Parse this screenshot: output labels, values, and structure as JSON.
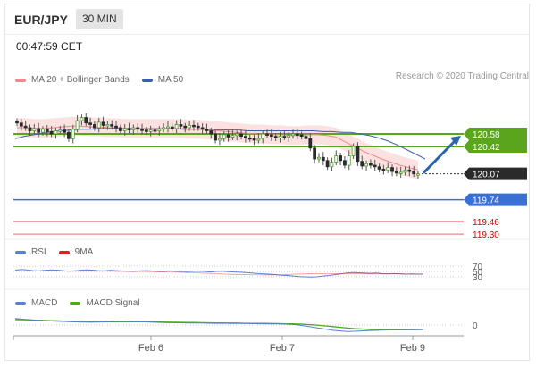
{
  "header": {
    "symbol": "EUR/JPY",
    "timeframe": "30 MIN",
    "time": "00:47:59 CET"
  },
  "credit": "Research © 2020 Trading Central",
  "colors": {
    "bull": "#4a9a2a",
    "green_line": "#5aa51c",
    "blue_line": "#3a6fd8",
    "red_line": "#e56b6b",
    "ma20": "#f08a8a",
    "ma50": "#3d5fa8",
    "band": "#fbd7d7",
    "arrow": "#2a66a8",
    "rsi": "#5b7fd4",
    "rsi9": "#e02020",
    "macd": "#5b7fd4",
    "signal": "#4caa18"
  },
  "legend": {
    "ma20": "MA 20 + Bollinger Bands",
    "ma50": "MA 50",
    "rsi": "RSI",
    "rsi9": "9MA",
    "macd": "MACD",
    "macd_signal": "MACD Signal"
  },
  "chart_data": [
    {
      "type": "line",
      "title": "",
      "y_range": [
        119.2,
        120.9
      ],
      "x_ticks": [
        "Feb 6",
        "Feb 7",
        "Feb 9"
      ],
      "candles_close": [
        120.72,
        120.68,
        120.66,
        120.62,
        120.65,
        120.6,
        120.64,
        120.61,
        120.58,
        120.62,
        120.63,
        120.6,
        120.52,
        120.64,
        120.75,
        120.79,
        120.72,
        120.7,
        120.66,
        120.73,
        120.69,
        120.7,
        120.68,
        120.66,
        120.62,
        120.65,
        120.63,
        120.66,
        120.64,
        120.63,
        120.61,
        120.63,
        120.62,
        120.64,
        120.66,
        120.67,
        120.65,
        120.7,
        120.68,
        120.66,
        120.69,
        120.68,
        120.66,
        120.64,
        120.62,
        120.58,
        120.5,
        120.52,
        120.57,
        120.54,
        120.56,
        120.58,
        120.55,
        120.53,
        120.52,
        120.5,
        120.52,
        120.58,
        120.57,
        120.55,
        120.53,
        120.55,
        120.54,
        120.56,
        120.58,
        120.57,
        120.55,
        120.52,
        120.4,
        120.26,
        120.28,
        120.24,
        120.16,
        120.22,
        120.3,
        120.24,
        120.18,
        120.3,
        120.42,
        120.23,
        120.17,
        120.2,
        120.18,
        120.16,
        120.13,
        120.12,
        120.15,
        120.1,
        120.08,
        120.09,
        120.12,
        120.1,
        120.07,
        120.07
      ],
      "ma50": [
        120.52,
        120.55,
        120.57,
        120.59,
        120.61,
        120.62,
        120.63,
        120.64,
        120.64,
        120.65,
        120.65,
        120.65,
        120.65,
        120.65,
        120.65,
        120.65,
        120.65,
        120.65,
        120.64,
        120.64,
        120.64,
        120.63,
        120.63,
        120.63,
        120.63,
        120.62,
        120.62,
        120.62,
        120.62,
        120.62,
        120.62,
        120.62,
        120.62,
        120.61,
        120.61,
        120.6,
        120.6,
        120.58,
        120.56,
        120.53,
        120.49,
        120.44,
        120.38,
        120.32,
        120.26
      ],
      "ma20": [
        120.66,
        120.66,
        120.65,
        120.65,
        120.66,
        120.67,
        120.68,
        120.68,
        120.67,
        120.67,
        120.66,
        120.66,
        120.65,
        120.65,
        120.65,
        120.65,
        120.65,
        120.65,
        120.65,
        120.64,
        120.64,
        120.63,
        120.62,
        120.61,
        120.6,
        120.59,
        120.58,
        120.58,
        120.57,
        120.57,
        120.56,
        120.56,
        120.57,
        120.57,
        120.56,
        120.54,
        120.48,
        120.42,
        120.36,
        120.31,
        120.26,
        120.22,
        120.18,
        120.15,
        120.12
      ],
      "levels": [
        {
          "label": "120.58",
          "value": 120.58,
          "color": "green"
        },
        {
          "label": "120.42",
          "value": 120.42,
          "color": "green"
        },
        {
          "label": "120.07",
          "value": 120.07,
          "color": "current"
        },
        {
          "label": "119.74",
          "value": 119.74,
          "color": "blue"
        },
        {
          "label": "119.46",
          "value": 119.46,
          "color": "red"
        },
        {
          "label": "119.30",
          "value": 119.3,
          "color": "red"
        }
      ],
      "forecast_arrow": {
        "from": 120.07,
        "to": 120.58
      }
    },
    {
      "type": "line",
      "title": "RSI",
      "y_range": [
        20,
        80
      ],
      "y_ticks": [
        "70",
        "50",
        "30"
      ],
      "rsi": [
        55,
        57,
        56,
        53,
        52,
        54,
        56,
        55,
        53,
        51,
        52,
        54,
        56,
        55,
        53,
        52,
        54,
        53,
        52,
        51,
        50,
        52,
        53,
        52,
        51,
        50,
        52,
        51,
        50,
        49,
        50,
        51,
        50,
        48,
        50,
        51,
        49,
        48,
        47,
        46,
        44,
        42,
        41,
        40,
        38,
        36,
        35,
        33,
        31,
        30,
        29,
        30,
        33,
        35,
        38,
        41,
        44,
        46,
        45,
        44,
        43,
        44,
        42,
        41,
        42,
        41,
        40,
        41,
        40,
        40
      ],
      "ma9": [
        52,
        52,
        52,
        52,
        52,
        51,
        51,
        51,
        51,
        50,
        50,
        50,
        49,
        48,
        47,
        45,
        44,
        42,
        40,
        39,
        38,
        37,
        37,
        38,
        40,
        41,
        42,
        42,
        42,
        42,
        41,
        41,
        41,
        41,
        40,
        40
      ]
    },
    {
      "type": "line",
      "title": "MACD",
      "y_range": [
        -0.15,
        0.15
      ],
      "y_ticks": [
        "0"
      ],
      "macd": [
        0.06,
        0.055,
        0.05,
        0.045,
        0.04,
        0.038,
        0.035,
        0.033,
        0.03,
        0.028,
        0.027,
        0.026,
        0.028,
        0.03,
        0.033,
        0.035,
        0.034,
        0.032,
        0.03,
        0.028,
        0.026,
        0.024,
        0.022,
        0.021,
        0.02,
        0.019,
        0.018,
        0.018,
        0.017,
        0.016,
        0.016,
        0.015,
        0.015,
        0.014,
        0.013,
        0.012,
        0.012,
        0.011,
        0.01,
        0.008,
        0.005,
        0.0,
        -0.01,
        -0.02,
        -0.03,
        -0.04,
        -0.05,
        -0.055,
        -0.06,
        -0.058,
        -0.055,
        -0.052,
        -0.05,
        -0.048,
        -0.046,
        -0.045,
        -0.044,
        -0.043,
        -0.042,
        -0.041
      ],
      "signal": [
        0.05,
        0.049,
        0.047,
        0.045,
        0.043,
        0.041,
        0.039,
        0.037,
        0.035,
        0.033,
        0.031,
        0.03,
        0.029,
        0.029,
        0.029,
        0.03,
        0.031,
        0.031,
        0.031,
        0.03,
        0.029,
        0.028,
        0.027,
        0.026,
        0.025,
        0.024,
        0.023,
        0.022,
        0.021,
        0.02,
        0.019,
        0.018,
        0.018,
        0.017,
        0.016,
        0.015,
        0.015,
        0.014,
        0.013,
        0.012,
        0.011,
        0.009,
        0.006,
        0.002,
        -0.003,
        -0.009,
        -0.015,
        -0.022,
        -0.028,
        -0.033,
        -0.037,
        -0.04,
        -0.042,
        -0.043,
        -0.044,
        -0.044,
        -0.044,
        -0.043,
        -0.043,
        -0.042
      ]
    }
  ]
}
